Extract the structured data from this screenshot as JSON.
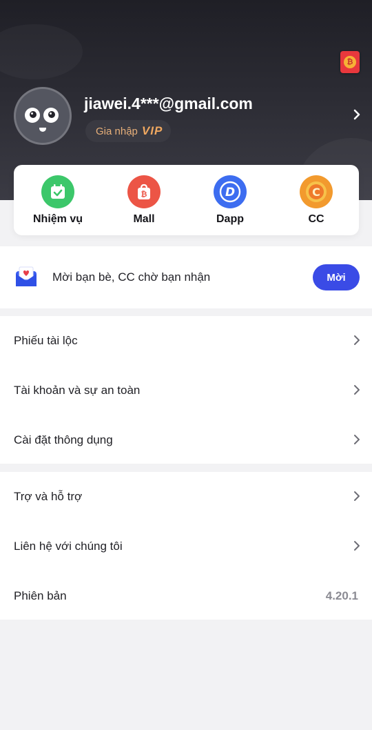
{
  "profile": {
    "username": "jiawei.4***@gmail.com",
    "join_text": "Gia nhập",
    "vip_text": "VIP"
  },
  "quick_actions": [
    {
      "label": "Nhiệm vụ",
      "icon": "calendar-check-icon",
      "color": "#3cc76a"
    },
    {
      "label": "Mall",
      "icon": "shopping-bag-icon",
      "color": "#ec5546"
    },
    {
      "label": "Dapp",
      "icon": "dapp-icon",
      "color": "#3d6df0"
    },
    {
      "label": "CC",
      "icon": "cc-coin-icon",
      "color": "#f29a2e"
    }
  ],
  "invite": {
    "text": "Mời bạn bè, CC chờ bạn nhận",
    "button": "Mời"
  },
  "menu_group_1": [
    {
      "label": "Phiếu tài lộc"
    },
    {
      "label": "Tài khoản và sự an toàn"
    },
    {
      "label": "Cài đặt thông dụng"
    }
  ],
  "menu_group_2": [
    {
      "label": "Trợ và hỗ trợ"
    },
    {
      "label": "Liên hệ với chúng tôi"
    },
    {
      "label": "Phiên bản",
      "value": "4.20.1"
    }
  ],
  "colors": {
    "accent": "#3a4be6",
    "header_bg": "#2b2b33",
    "vip_gold": "#f0a860"
  }
}
